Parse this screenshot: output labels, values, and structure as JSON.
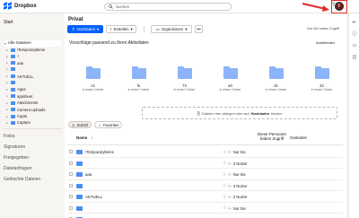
{
  "topbar": {
    "app_name": "Dropbox",
    "search_placeholder": "Suchen",
    "avatar_initial": "F"
  },
  "sidebar": {
    "start": "Start",
    "all_files": "Alle Dateien",
    "tree": [
      {
        "label": "!Temporarylteme",
        "blue": false
      },
      {
        "label": "+ ",
        "blue": false
      },
      {
        "label": "aaa",
        "blue": false
      },
      {
        "label": "",
        "blue": false
      },
      {
        "label": "AKTUELL",
        "blue": false
      },
      {
        "label": "",
        "blue": false
      },
      {
        "label": "Apps",
        "blue": false
      },
      {
        "label": "appsheet",
        "blue": false
      },
      {
        "label": "Attachments",
        "blue": false
      },
      {
        "label": "Camera Uploads",
        "blue": false
      },
      {
        "label": "Capto",
        "blue": false
      },
      {
        "label": "Capture",
        "blue": false
      }
    ],
    "sections": [
      "Fotos",
      "Signaturen",
      "Freigegeben",
      "Dateianfragen",
      "Gelöschte Dateien"
    ]
  },
  "main": {
    "title": "Privat",
    "upload_label": "Hochladen",
    "create_label": "Erstellen",
    "organize_label": "Organisieren",
    "more_label": "•••",
    "only_you": "Nur Sie haben Zugriff",
    "suggestions_title": "Vorschläge passend zu Ihren Aktivitäten",
    "hide_label": "Ausblenden",
    "suggestions": [
      {
        "name": "c2",
        "sub": "In einem Ordner"
      },
      {
        "name": "fo",
        "sub": "In einem Ordner"
      },
      {
        "name": "73",
        "sub": "In einem Ordner"
      },
      {
        "name": "a0",
        "sub": "In einem Ordner"
      },
      {
        "name": "dc",
        "sub": "In einem Ordner"
      },
      {
        "name": "42",
        "sub": "In einem Ordner"
      }
    ],
    "dropzone_pre": "Dateien hier ablegen oder auf",
    "dropzone_bold": "Hochladen",
    "dropzone_post": "klicken",
    "filter_recent": "Zuletzt",
    "filter_favorites": "Favoriten",
    "col_name": "Name",
    "col_access": "Diese Personen haben Zugriff",
    "col_changed": "Geändert",
    "rows": [
      {
        "name": "!Temporarylteme",
        "access": "Nur Sie"
      },
      {
        "name": "",
        "access": "2 Nutzer"
      },
      {
        "name": "aaa",
        "access": "Nur Sie"
      },
      {
        "name": "",
        "access": "3 Nutzer"
      },
      {
        "name": "AKTUELL",
        "access": "2 Nutzer"
      },
      {
        "name": "",
        "access": "Nur Sie"
      },
      {
        "name": "Apps",
        "access": "Nur Sie"
      }
    ]
  },
  "colors": {
    "accent": "#0061fe",
    "folder": "#4d8df0",
    "highlight": "#e32b2b"
  }
}
